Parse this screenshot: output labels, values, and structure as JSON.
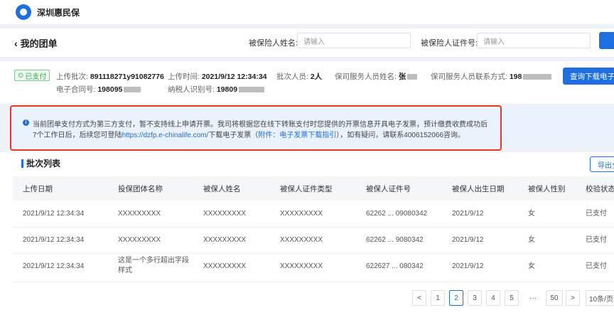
{
  "app": {
    "name": "深圳惠民保"
  },
  "header": {
    "back_title": "我的团单",
    "insured_name_label": "被保险人姓名:",
    "insured_name_placeholder": "请输入",
    "insured_id_label": "被保险人证件号:",
    "insured_id_placeholder": "请输入"
  },
  "info": {
    "status": "已支付",
    "batch_label": "上传批次:",
    "batch_value": "891118271y91082776",
    "upload_time_label": "上传时间:",
    "upload_time_value": "2021/9/12 12:34:34",
    "people_label": "批次人员:",
    "people_value": "2人",
    "service_name_label": "保司服务人员姓名:",
    "service_name_value": "张",
    "service_contact_label": "保司服务人员联系方式:",
    "service_contact_value": "198",
    "contract_label": "电子合同号:",
    "contract_value": "198095",
    "taxpayer_label": "纳税人识别号:",
    "taxpayer_value": "19809",
    "download_button": "查询下载电子发票"
  },
  "notice": {
    "line1": "当前团单支付方式为第三方支付，暂不支持线上申请开票。我司将根据您在线下转账支付时您提供的开票信息开具电子发票，预计缴费收费成功后",
    "line2_a": "7个工作日后，后续您可登陆",
    "line2_link": "https://dzfp.e-chinalife.com/",
    "line2_b": "下载电子发票（",
    "line2_guide": "附件：电子发票下载指引",
    "line2_c": "），如有疑问，请联系4006152066咨询。"
  },
  "list": {
    "title": "批次列表",
    "export_button": "导出全部",
    "columns": [
      "上传日期",
      "投保团体名称",
      "被保人姓名",
      "被保人证件类型",
      "被保人证件号",
      "被保人出生日期",
      "被保人性别",
      "校验状态"
    ],
    "rows": [
      [
        "2021/9/12 12:34:34",
        "XXXXXXXXX",
        "XXXXXXXXX",
        "XXXXXXXXX",
        "62262 ... 09080342",
        "2021/9/12",
        "女",
        "已支付"
      ],
      [
        "2021/9/12 12:34:34",
        "XXXXXXXXX",
        "XXXXXXXXX",
        "XXXXXXXXX",
        "62262 ... 9080342",
        "2021/9/12",
        "女",
        "已支付"
      ],
      [
        "2021/9/12 12:34:34",
        "这是一个多行超出字段样式",
        "XXXXXXXXX",
        "XXXXXXXXX",
        "622627 ... 080342",
        "2021/9/12",
        "女",
        "已支付"
      ]
    ]
  },
  "pager": {
    "prev": "<",
    "pages": [
      "1",
      "2",
      "3",
      "4",
      "5"
    ],
    "active_page": "2",
    "ellipsis": "···",
    "last": "50",
    "next": ">",
    "page_size": "10条/页"
  }
}
